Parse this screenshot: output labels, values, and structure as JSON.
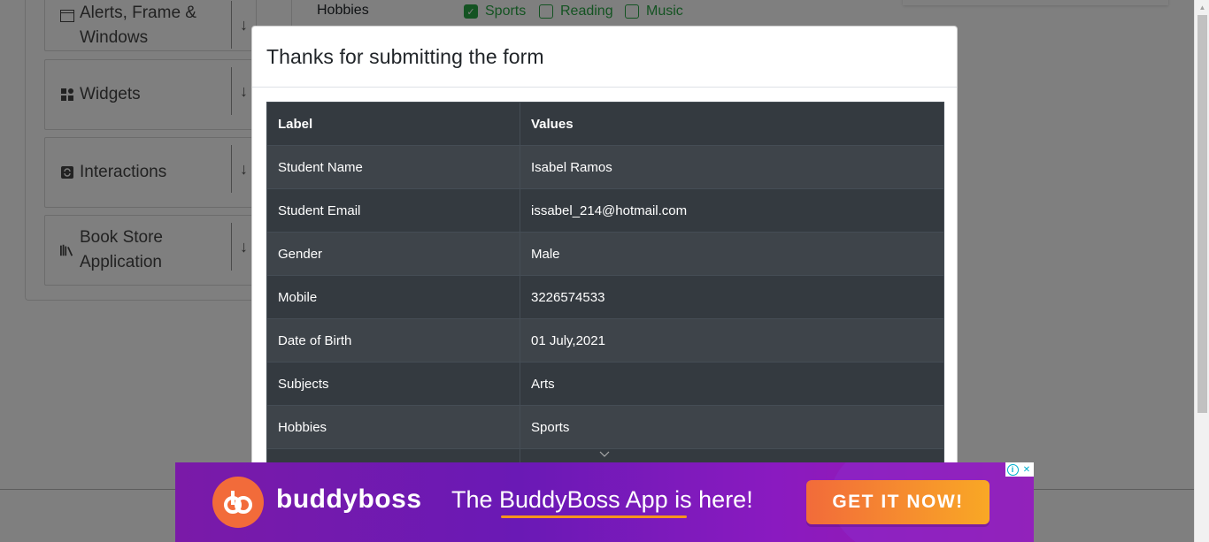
{
  "sidebar": {
    "groups": [
      {
        "label": "Alerts, Frame & Windows",
        "icon": "window-icon"
      },
      {
        "label": "Widgets",
        "icon": "widgets-icon"
      },
      {
        "label": "Interactions",
        "icon": "interactions-icon"
      },
      {
        "label": "Book Store Application",
        "icon": "books-icon"
      }
    ]
  },
  "form_background": {
    "hobbies_label": "Hobbies",
    "hobbies": [
      {
        "label": "Sports",
        "checked": true
      },
      {
        "label": "Reading",
        "checked": false
      },
      {
        "label": "Music",
        "checked": false
      }
    ]
  },
  "modal": {
    "title": "Thanks for submitting the form",
    "table": {
      "headers": [
        "Label",
        "Values"
      ],
      "rows": [
        [
          "Student Name",
          "Isabel Ramos"
        ],
        [
          "Student Email",
          "issabel_214@hotmail.com"
        ],
        [
          "Gender",
          "Male"
        ],
        [
          "Mobile",
          "3226574533"
        ],
        [
          "Date of Birth",
          "01 July,2021"
        ],
        [
          "Subjects",
          "Arts"
        ],
        [
          "Hobbies",
          "Sports"
        ]
      ]
    }
  },
  "ad": {
    "brand": "buddyboss",
    "headline": "The BuddyBoss App is here!",
    "cta": "GET IT NOW!",
    "colors": {
      "accent": "#f26b3a",
      "background": "#7a1aa8"
    }
  }
}
